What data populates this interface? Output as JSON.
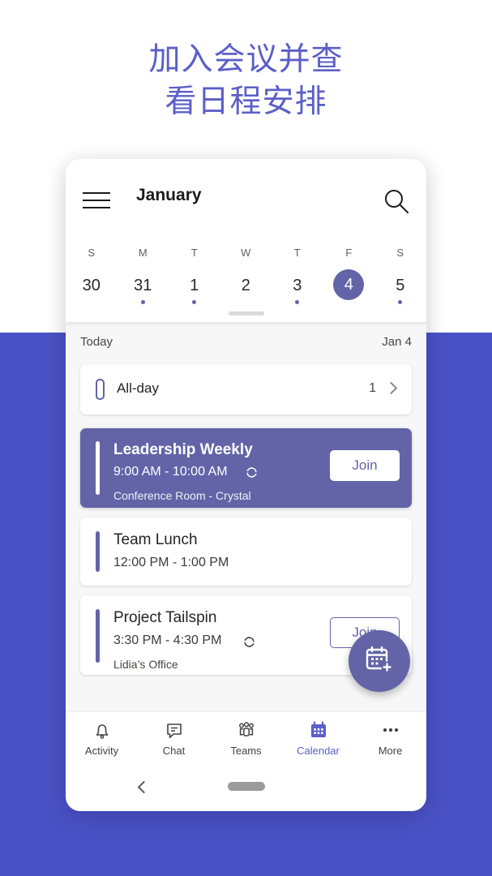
{
  "promo": {
    "headline": "加入会议并查\n看日程安排",
    "headline_color": "#5b5fc7",
    "background_color": "#4a51c4"
  },
  "app": {
    "accent_color": "#6264a7",
    "header": {
      "menu_icon": "hamburger-icon",
      "title": "January",
      "search_icon": "search-icon"
    },
    "week_strip": [
      {
        "weekday": "S",
        "day": "30",
        "has_event": false,
        "selected": false
      },
      {
        "weekday": "M",
        "day": "31",
        "has_event": true,
        "selected": false
      },
      {
        "weekday": "T",
        "day": "1",
        "has_event": true,
        "selected": false
      },
      {
        "weekday": "W",
        "day": "2",
        "has_event": false,
        "selected": false
      },
      {
        "weekday": "T",
        "day": "3",
        "has_event": true,
        "selected": false
      },
      {
        "weekday": "F",
        "day": "4",
        "has_event": false,
        "selected": true
      },
      {
        "weekday": "S",
        "day": "5",
        "has_event": true,
        "selected": false
      }
    ],
    "agenda": {
      "today_label": "Today",
      "today_date": "Jan 4",
      "allday": {
        "label": "All-day",
        "count": "1",
        "chevron_icon": "chevron-right-icon"
      },
      "events": [
        {
          "title": "Leadership Weekly",
          "time": "9:00 AM - 10:00 AM",
          "location": "Conference Room -  Crystal",
          "recurring": true,
          "recurring_icon": "recurrence-icon",
          "join_label": "Join",
          "highlighted": true
        },
        {
          "title": "Team Lunch",
          "time": "12:00 PM - 1:00 PM",
          "location": "",
          "recurring": false,
          "recurring_icon": "",
          "join_label": "",
          "highlighted": false
        },
        {
          "title": "Project Tailspin",
          "time": "3:30 PM - 4:30 PM",
          "location": "Lidia’s Office",
          "recurring": true,
          "recurring_icon": "recurrence-icon",
          "join_label": "Join",
          "highlighted": false
        }
      ]
    },
    "fab": {
      "icon": "calendar-add-icon",
      "color": "#6264a7"
    },
    "bottom_nav": [
      {
        "label": "Activity",
        "icon": "bell-icon",
        "active": false
      },
      {
        "label": "Chat",
        "icon": "chat-icon",
        "active": false
      },
      {
        "label": "Teams",
        "icon": "teams-icon",
        "active": false
      },
      {
        "label": "Calendar",
        "icon": "calendar-icon",
        "active": true
      },
      {
        "label": "More",
        "icon": "more-icon",
        "active": false
      }
    ],
    "system_nav": {
      "back_icon": "back-chevron-icon",
      "home_icon": "home-pill-icon"
    }
  }
}
